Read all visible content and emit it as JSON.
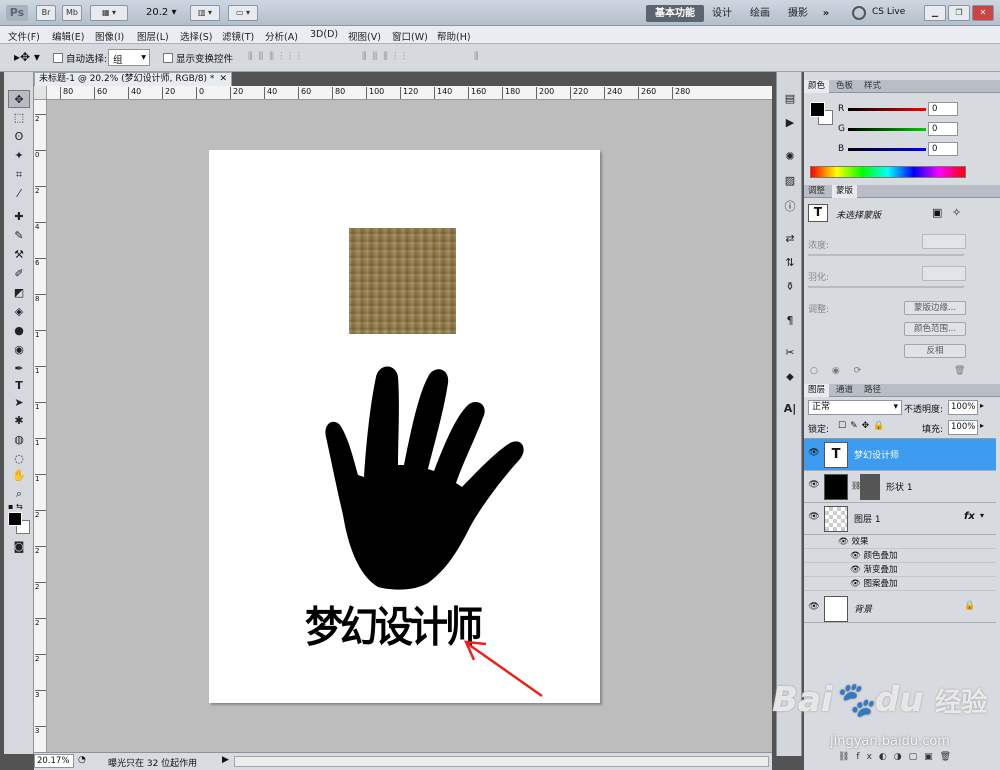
{
  "app": {
    "logo": "Ps",
    "mb_button": "Mb",
    "br_button": "Br",
    "zoom_value": "20.2",
    "workspace_active": "基本功能",
    "workspaces": [
      "设计",
      "绘画",
      "摄影"
    ],
    "more_label": "»",
    "cslive_label": "CS Live"
  },
  "menu": [
    "文件(F)",
    "编辑(E)",
    "图像(I)",
    "图层(L)",
    "选择(S)",
    "滤镜(T)",
    "分析(A)",
    "3D(D)",
    "视图(V)",
    "窗口(W)",
    "帮助(H)"
  ],
  "options": {
    "auto_select_label": "自动选择:",
    "auto_select_value": "组",
    "show_transform_label": "显示变换控件"
  },
  "document": {
    "tab_title": "未标题-1 @ 20.2% (梦幻设计师, RGB/8) *",
    "ruler_h": [
      "80",
      "60",
      "40",
      "20",
      "0",
      "20",
      "40",
      "60",
      "80",
      "100",
      "120",
      "140",
      "160",
      "180",
      "200",
      "220",
      "240",
      "260",
      "280"
    ],
    "ruler_v": [
      "2",
      "0",
      "2",
      "4",
      "6",
      "8",
      "1",
      "1",
      "1",
      "1",
      "1",
      "2",
      "2",
      "2",
      "2",
      "2",
      "3",
      "3"
    ],
    "artwork_text": "梦幻设计师"
  },
  "status": {
    "zoom": "20.17%",
    "message": "曝光只在 32 位起作用"
  },
  "color_panel": {
    "tabs": [
      "颜色",
      "色板",
      "样式"
    ],
    "channels": [
      {
        "label": "R",
        "value": "0",
        "color": "#d00000"
      },
      {
        "label": "G",
        "value": "0",
        "color": "#00b000"
      },
      {
        "label": "B",
        "value": "0",
        "color": "#0000d0"
      }
    ]
  },
  "mask_panel": {
    "tabs": [
      "调整",
      "蒙版"
    ],
    "no_mask_label": "未选择蒙版",
    "density_label": "浓度:",
    "feather_label": "羽化:",
    "refine_label": "调整:",
    "mask_edge_button": "蒙版边缘...",
    "color_range_button": "颜色范围...",
    "invert_button": "反相"
  },
  "layers_panel": {
    "tabs": [
      "图层",
      "通道",
      "路径"
    ],
    "blend_mode": "正常",
    "opacity_label": "不透明度:",
    "opacity_value": "100%",
    "lock_label": "锁定:",
    "fill_label": "填充:",
    "fill_value": "100%",
    "layers": [
      {
        "name": "梦幻设计师",
        "type": "text",
        "selected": true
      },
      {
        "name": "形状 1",
        "type": "shape",
        "selected": false
      },
      {
        "name": "图层 1",
        "type": "pattern",
        "selected": false,
        "fx": "fx"
      },
      {
        "name": "背景",
        "type": "background",
        "selected": false
      }
    ],
    "effects_label": "效果",
    "effects": [
      "颜色叠加",
      "渐变叠加",
      "图案叠加"
    ]
  },
  "watermark": {
    "brand": "Bai",
    "brand2": "du",
    "cn": "经验",
    "url": "jingyan.baidu.com"
  }
}
